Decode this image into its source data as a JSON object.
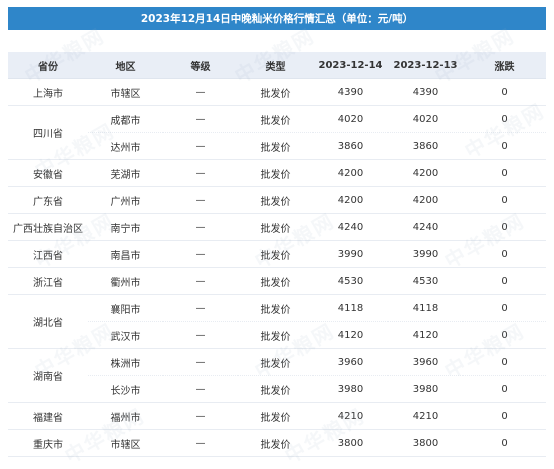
{
  "title": "2023年12月14日中晚籼米价格行情汇总（单位：元/吨）",
  "headers": [
    "省份",
    "地区",
    "等级",
    "类型",
    "2023-12-14",
    "2023-12-13",
    "涨跌"
  ],
  "rows": [
    {
      "province": "上海市",
      "region": "市辖区",
      "grade": "—",
      "type": "批发价",
      "price_today": "4390",
      "price_prev": "4390",
      "change": "0"
    },
    {
      "province": "四川省",
      "region": "成都市",
      "grade": "—",
      "type": "批发价",
      "price_today": "4020",
      "price_prev": "4020",
      "change": "0"
    },
    {
      "province": "",
      "region": "达州市",
      "grade": "—",
      "type": "批发价",
      "price_today": "3860",
      "price_prev": "3860",
      "change": "0"
    },
    {
      "province": "安徽省",
      "region": "芜湖市",
      "grade": "—",
      "type": "批发价",
      "price_today": "4200",
      "price_prev": "4200",
      "change": "0"
    },
    {
      "province": "广东省",
      "region": "广州市",
      "grade": "—",
      "type": "批发价",
      "price_today": "4200",
      "price_prev": "4200",
      "change": "0"
    },
    {
      "province": "广西壮族自治区",
      "region": "南宁市",
      "grade": "—",
      "type": "批发价",
      "price_today": "4240",
      "price_prev": "4240",
      "change": "0"
    },
    {
      "province": "江西省",
      "region": "南昌市",
      "grade": "—",
      "type": "批发价",
      "price_today": "3990",
      "price_prev": "3990",
      "change": "0"
    },
    {
      "province": "浙江省",
      "region": "衢州市",
      "grade": "—",
      "type": "批发价",
      "price_today": "4530",
      "price_prev": "4530",
      "change": "0"
    },
    {
      "province": "湖北省",
      "region": "襄阳市",
      "grade": "—",
      "type": "批发价",
      "price_today": "4118",
      "price_prev": "4118",
      "change": "0"
    },
    {
      "province": "",
      "region": "武汉市",
      "grade": "—",
      "type": "批发价",
      "price_today": "4120",
      "price_prev": "4120",
      "change": "0"
    },
    {
      "province": "湖南省",
      "region": "株洲市",
      "grade": "—",
      "type": "批发价",
      "price_today": "3960",
      "price_prev": "3960",
      "change": "0"
    },
    {
      "province": "",
      "region": "长沙市",
      "grade": "—",
      "type": "批发价",
      "price_today": "3980",
      "price_prev": "3980",
      "change": "0"
    },
    {
      "province": "福建省",
      "region": "福州市",
      "grade": "—",
      "type": "批发价",
      "price_today": "4210",
      "price_prev": "4210",
      "change": "0"
    },
    {
      "province": "重庆市",
      "region": "市辖区",
      "grade": "—",
      "type": "批发价",
      "price_today": "3800",
      "price_prev": "3800",
      "change": "0"
    }
  ],
  "watermark": "中华粮网",
  "colors": {
    "title_bg": "#2f86c9",
    "header_bg": "#e9eef6"
  }
}
